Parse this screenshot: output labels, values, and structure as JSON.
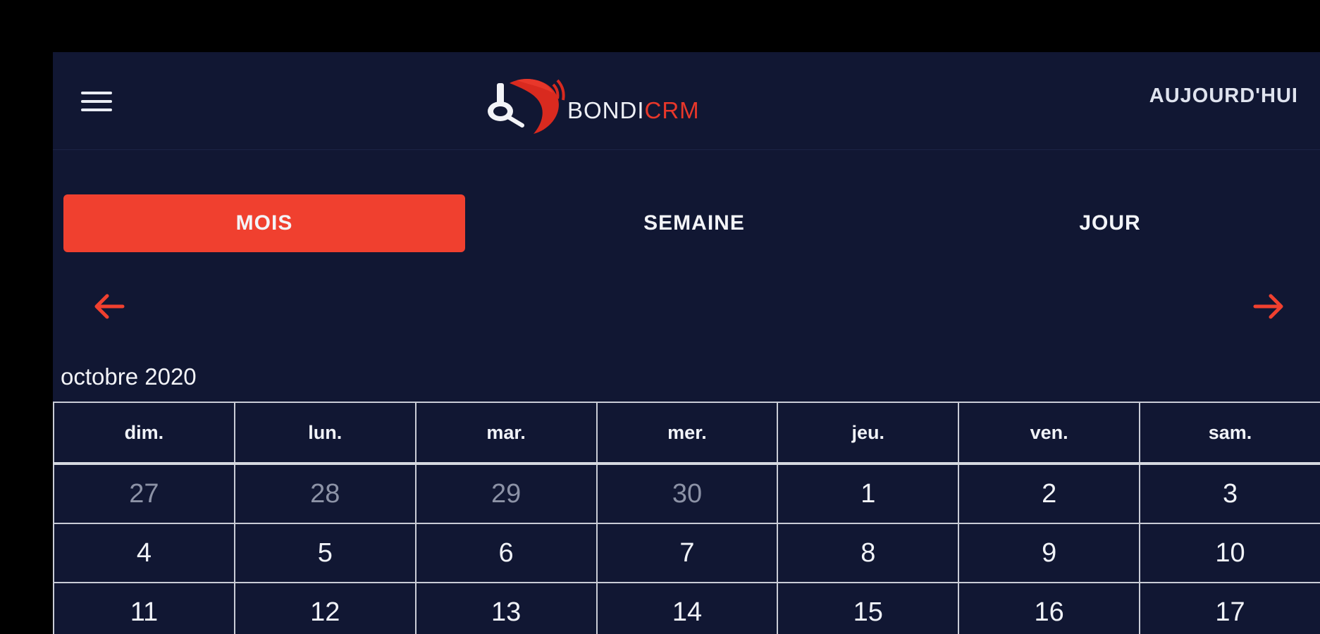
{
  "header": {
    "menu_icon": "hamburger-menu-icon",
    "logo_text_main": "BONDI",
    "logo_text_accent": "CRM",
    "today_label": "AUJOURD'HUI"
  },
  "view_tabs": [
    {
      "label": "MOIS",
      "active": true
    },
    {
      "label": "SEMAINE",
      "active": false
    },
    {
      "label": "JOUR",
      "active": false
    }
  ],
  "navigation": {
    "prev_icon": "arrow-left-icon",
    "next_icon": "arrow-right-icon"
  },
  "calendar": {
    "month_label": "octobre 2020",
    "weekdays": [
      "dim.",
      "lun.",
      "mar.",
      "mer.",
      "jeu.",
      "ven.",
      "sam."
    ],
    "weeks": [
      [
        {
          "d": "27",
          "muted": true
        },
        {
          "d": "28",
          "muted": true
        },
        {
          "d": "29",
          "muted": true
        },
        {
          "d": "30",
          "muted": true
        },
        {
          "d": "1"
        },
        {
          "d": "2"
        },
        {
          "d": "3"
        }
      ],
      [
        {
          "d": "4"
        },
        {
          "d": "5"
        },
        {
          "d": "6"
        },
        {
          "d": "7"
        },
        {
          "d": "8"
        },
        {
          "d": "9"
        },
        {
          "d": "10"
        }
      ],
      [
        {
          "d": "11"
        },
        {
          "d": "12"
        },
        {
          "d": "13"
        },
        {
          "d": "14"
        },
        {
          "d": "15"
        },
        {
          "d": "16"
        },
        {
          "d": "17"
        }
      ]
    ]
  },
  "colors": {
    "background": "#111733",
    "accent": "#f0402f",
    "text": "#f1f3f8",
    "muted_text": "#8c92a6",
    "grid": "#c9ccd6"
  }
}
